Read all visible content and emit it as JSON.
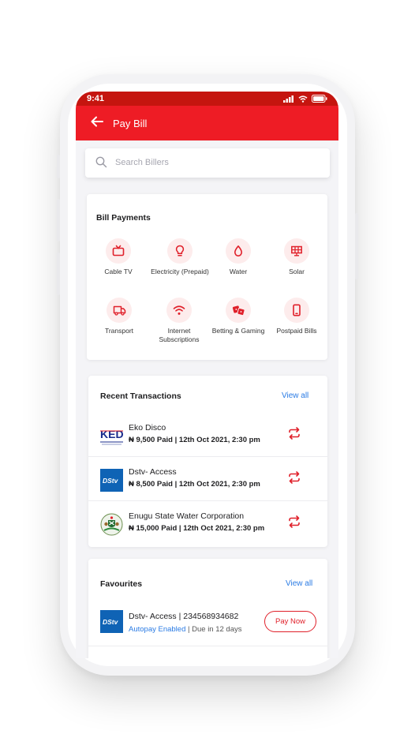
{
  "status": {
    "time": "9:41"
  },
  "header": {
    "title": "Pay Bill"
  },
  "search": {
    "placeholder": "Search Billers"
  },
  "bill_payments": {
    "title": "Bill Payments",
    "items": [
      {
        "label": "Cable TV",
        "icon": "tv-icon"
      },
      {
        "label": "Electricity (Prepaid)",
        "icon": "lightbulb-icon"
      },
      {
        "label": "Water",
        "icon": "water-drop-icon"
      },
      {
        "label": "Solar",
        "icon": "solar-panel-icon"
      },
      {
        "label": "Transport",
        "icon": "truck-icon"
      },
      {
        "label": "Internet Subscriptions",
        "icon": "wifi-icon"
      },
      {
        "label": "Betting & Gaming",
        "icon": "dice-icon"
      },
      {
        "label": "Postpaid Bills",
        "icon": "smartphone-icon"
      }
    ]
  },
  "recent": {
    "title": "Recent Transactions",
    "view_all": "View all",
    "items": [
      {
        "name": "Eko Disco",
        "meta": "₦ 9,500 Paid | 12th Oct 2021, 2:30 pm",
        "logo": "ekedc-logo"
      },
      {
        "name": "Dstv- Access",
        "meta": "₦ 8,500 Paid | 12th Oct 2021, 2:30 pm",
        "logo": "dstv-logo"
      },
      {
        "name": "Enugu State Water Corporation",
        "meta": "₦ 15,000 Paid | 12th Oct 2021, 2:30 pm",
        "logo": "coat-of-arms-logo"
      }
    ]
  },
  "favourites": {
    "title": "Favourites",
    "view_all": "View all",
    "items": [
      {
        "name": "Dstv- Access | 234568934682",
        "autopay": "Autopay Enabled",
        "due": " | Due in 12 days",
        "button": "Pay Now",
        "logo": "dstv-logo"
      }
    ]
  },
  "colors": {
    "brand_red": "#ee1c25",
    "link_blue": "#2a7be4",
    "icon_bg": "#fdecec"
  }
}
